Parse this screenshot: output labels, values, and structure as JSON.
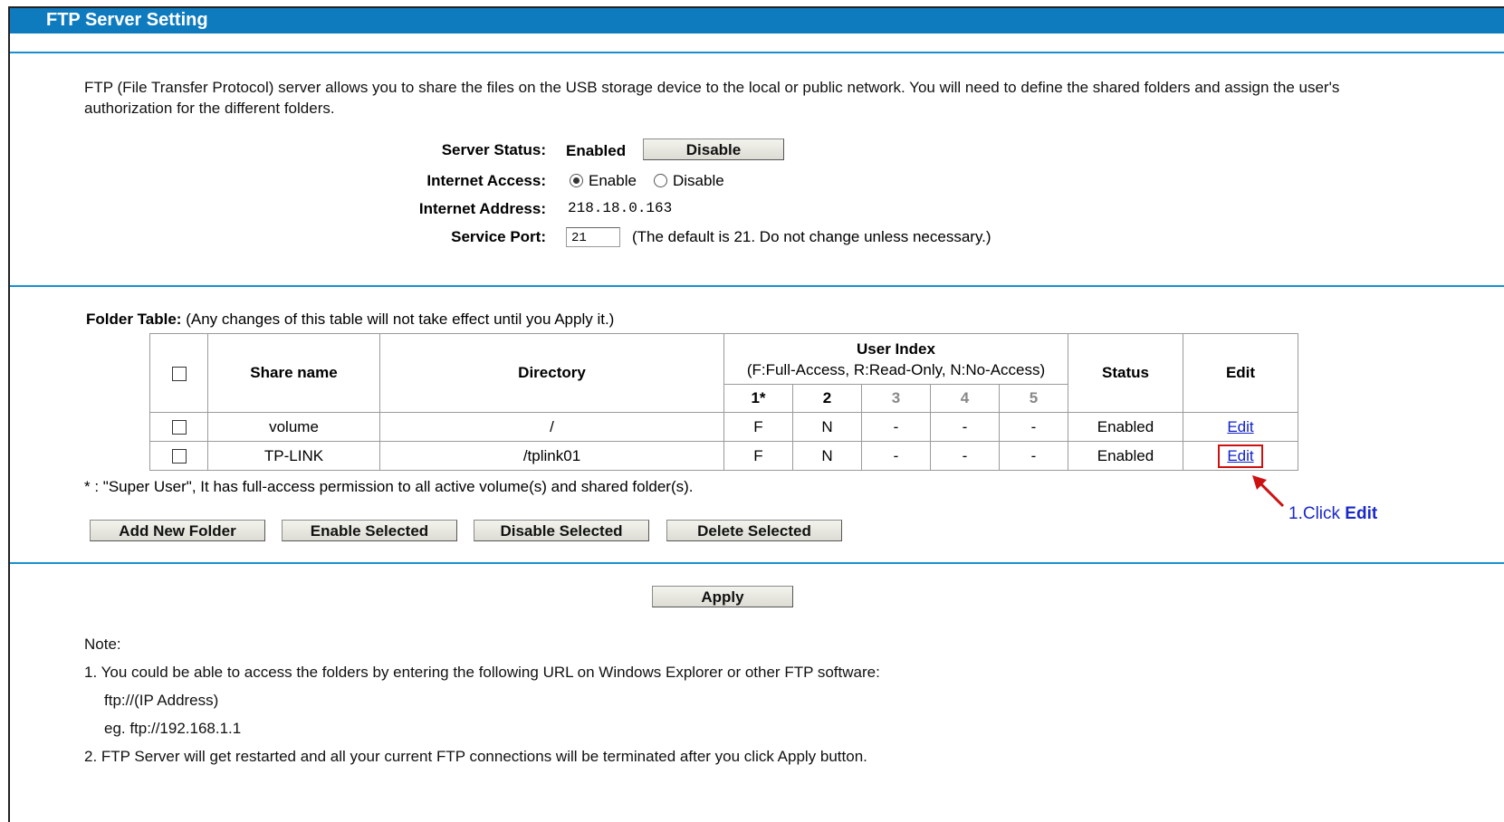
{
  "page": {
    "title": "FTP Server Setting",
    "description": "FTP (File Transfer Protocol) server allows you to share the files on the USB storage device to the local or public network. You will need to define the shared folders and assign the user's authorization for the different folders."
  },
  "server": {
    "status_label": "Server Status:",
    "status_value": "Enabled",
    "disable_button": "Disable",
    "internet_access_label": "Internet Access:",
    "internet_access_options": [
      "Enable",
      "Disable"
    ],
    "internet_access_selected": "Enable",
    "internet_address_label": "Internet Address:",
    "internet_address_value": "218.18.0.163",
    "service_port_label": "Service Port:",
    "service_port_value": "21",
    "service_port_hint": "(The default is 21. Do not change unless necessary.)"
  },
  "folder_table": {
    "label": "Folder Table:",
    "hint": "(Any changes of this table will not take effect until you Apply it.)",
    "headers": {
      "share_name": "Share name",
      "directory": "Directory",
      "user_index": "User Index",
      "user_index_legend": "(F:Full-Access, R:Read-Only, N:No-Access)",
      "status": "Status",
      "edit": "Edit",
      "user_cols": [
        "1*",
        "2",
        "3",
        "4",
        "5"
      ]
    },
    "rows": [
      {
        "share_name": "volume",
        "directory": "/",
        "u1": "F",
        "u2": "N",
        "u3": "-",
        "u4": "-",
        "u5": "-",
        "status": "Enabled",
        "edit": "Edit"
      },
      {
        "share_name": "TP-LINK",
        "directory": "/tplink01",
        "u1": "F",
        "u2": "N",
        "u3": "-",
        "u4": "-",
        "u5": "-",
        "status": "Enabled",
        "edit": "Edit"
      }
    ],
    "footnote": "* : \"Super User\", It has full-access permission to all active volume(s) and shared folder(s)."
  },
  "actions": {
    "add_new_folder": "Add New Folder",
    "enable_selected": "Enable Selected",
    "disable_selected": "Disable Selected",
    "delete_selected": "Delete Selected",
    "apply": "Apply"
  },
  "callout": {
    "prefix": "1.Click ",
    "bold": "Edit",
    "color": "#1a28c8",
    "highlight_color": "#cc1111"
  },
  "notes": {
    "title": "Note:",
    "line1": "1. You could be able to access the folders by entering the following URL on Windows Explorer or other FTP software:",
    "line2": "ftp://(IP Address)",
    "line3": "eg. ftp://192.168.1.1",
    "line4": "2. FTP Server will get restarted and all your current FTP connections will be terminated after you click Apply button."
  }
}
